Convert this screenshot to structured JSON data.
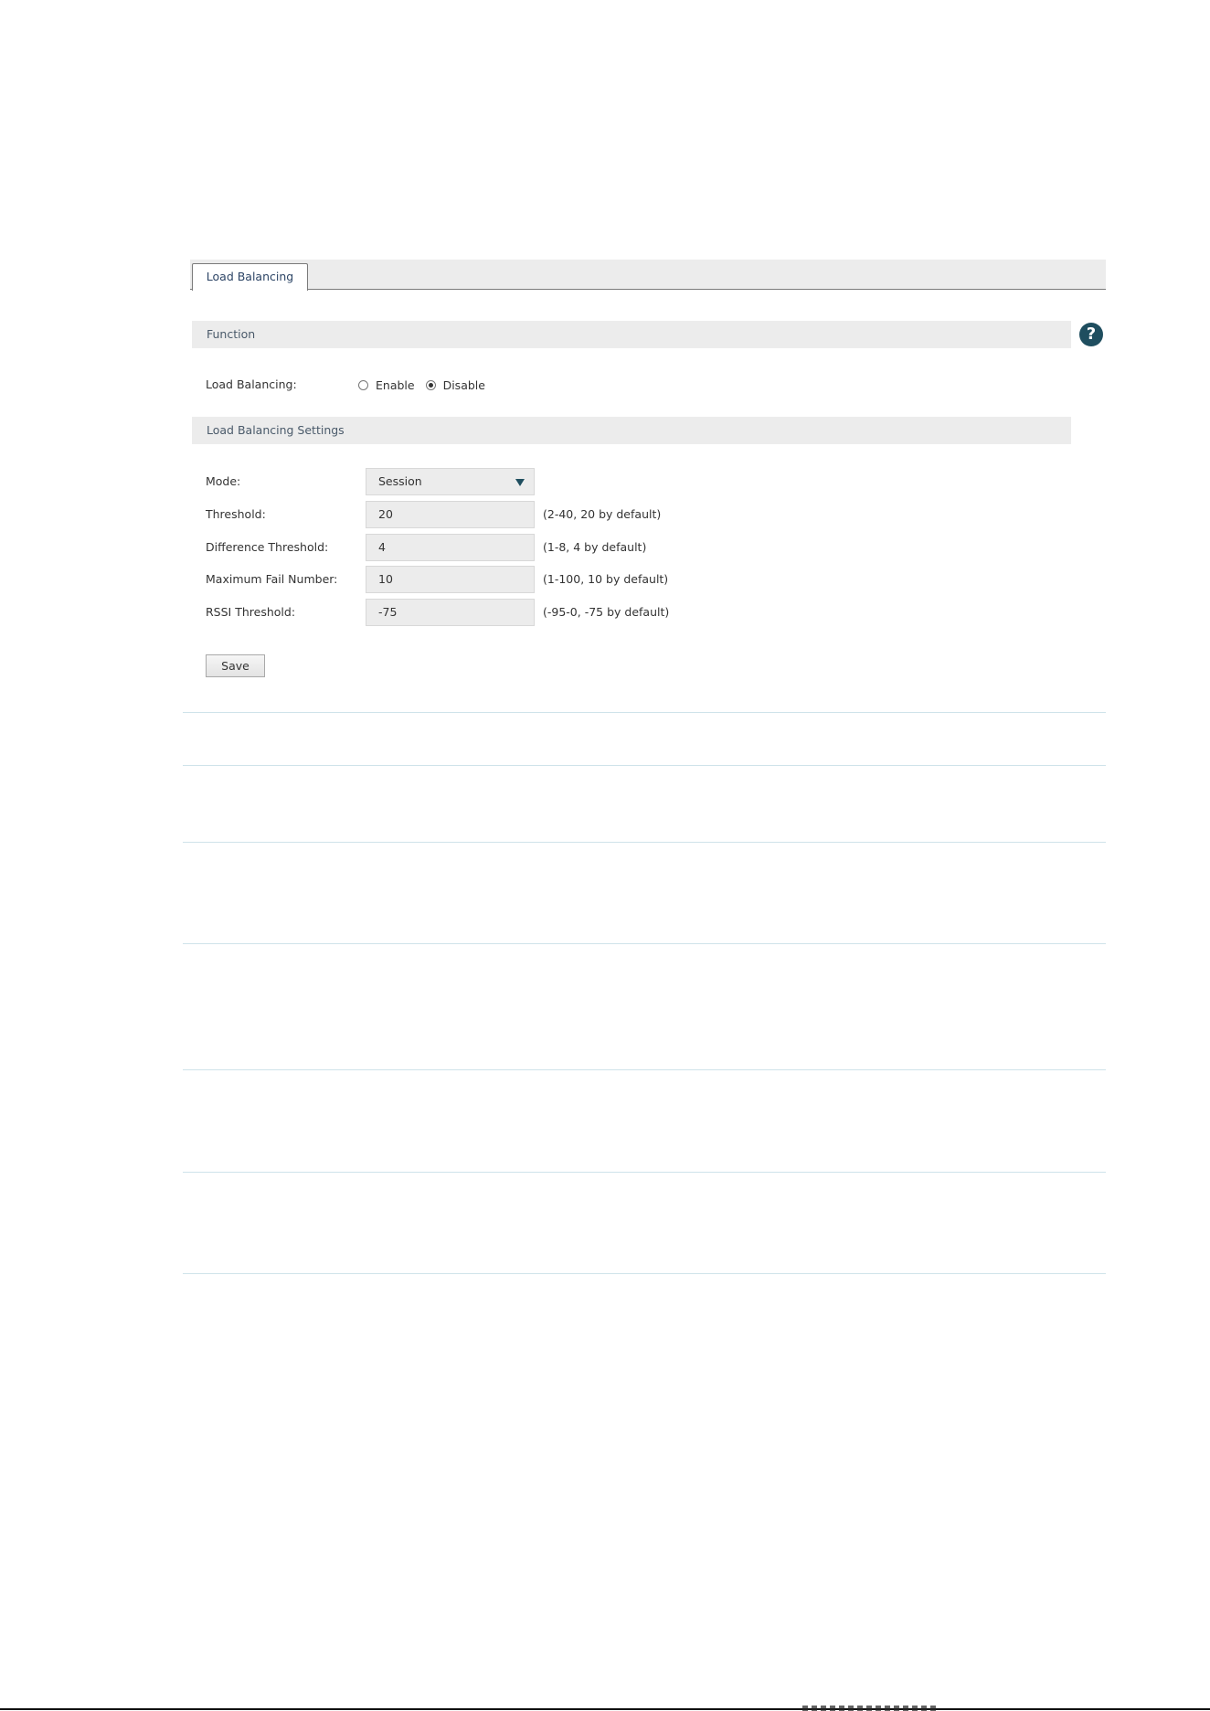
{
  "tabs": [
    {
      "label": "Load Balancing",
      "active": true
    }
  ],
  "function_section": {
    "title": "Function",
    "load_balancing": {
      "label": "Load Balancing:",
      "options": [
        {
          "label": "Enable",
          "checked": false
        },
        {
          "label": "Disable",
          "checked": true
        }
      ]
    }
  },
  "settings_section": {
    "title": "Load Balancing Settings",
    "mode": {
      "label": "Mode:",
      "value": "Session"
    },
    "threshold": {
      "label": "Threshold:",
      "value": "20",
      "hint": "(2-40, 20 by default)"
    },
    "difference_threshold": {
      "label": "Difference Threshold:",
      "value": "4",
      "hint": "(1-8, 4 by default)"
    },
    "max_fail_number": {
      "label": "Maximum Fail Number:",
      "value": "10",
      "hint": "(1-100, 10 by default)"
    },
    "rssi_threshold": {
      "label": "RSSI Threshold:",
      "value": "-75",
      "hint": "(-95-0, -75 by default)"
    },
    "save_label": "Save"
  },
  "icons": {
    "help": "help-icon",
    "dropdown": "chevron-down-icon"
  },
  "colors": {
    "header_bg": "#ececec",
    "help_icon": "#1f4e5f",
    "tab_text": "#2d4566",
    "divider": "#cfe3ea"
  }
}
